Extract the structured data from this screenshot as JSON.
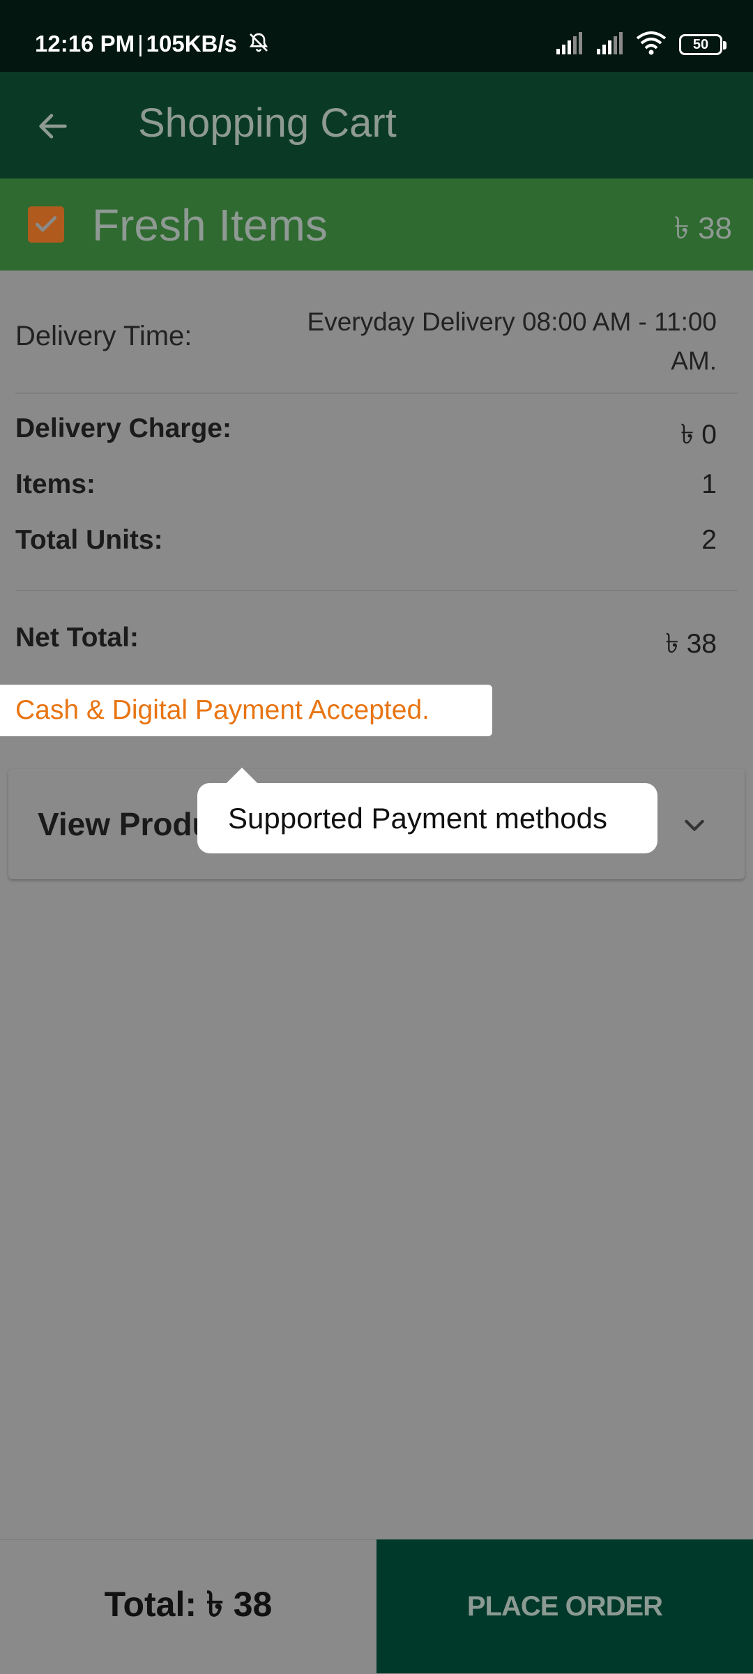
{
  "status_bar": {
    "time": "12:16 PM",
    "network_speed": "105KB/s",
    "battery": "50"
  },
  "app_bar": {
    "title": "Shopping Cart"
  },
  "category": {
    "label": "Fresh Items",
    "amount": "৳ 38",
    "checked": true
  },
  "summary": {
    "delivery_time_label": "Delivery Time:",
    "delivery_time_value": "Everyday Delivery 08:00 AM - 11:00 AM.",
    "delivery_charge_label": "Delivery Charge:",
    "delivery_charge_value": "৳ 0",
    "items_label": "Items:",
    "items_value": "1",
    "total_units_label": "Total Units:",
    "total_units_value": "2",
    "net_total_label": "Net Total:",
    "net_total_value": "৳ 38"
  },
  "payment": {
    "accepted_text": "Cash & Digital Payment Accepted."
  },
  "products_section": {
    "label": "View Produ"
  },
  "tooltip": {
    "text": "Supported Payment methods"
  },
  "bottom_bar": {
    "total": "Total: ৳ 38",
    "place_order": "PLACE ORDER"
  },
  "colors": {
    "status_bar_bg": "#031610",
    "app_bar_bg": "#0a3a25",
    "category_header_bg": "#2f6a30",
    "checkbox": "#b05a1e",
    "accent_orange": "#e87412",
    "place_order_bg": "#00382a",
    "overlay_gray": "#8a8a8a"
  }
}
